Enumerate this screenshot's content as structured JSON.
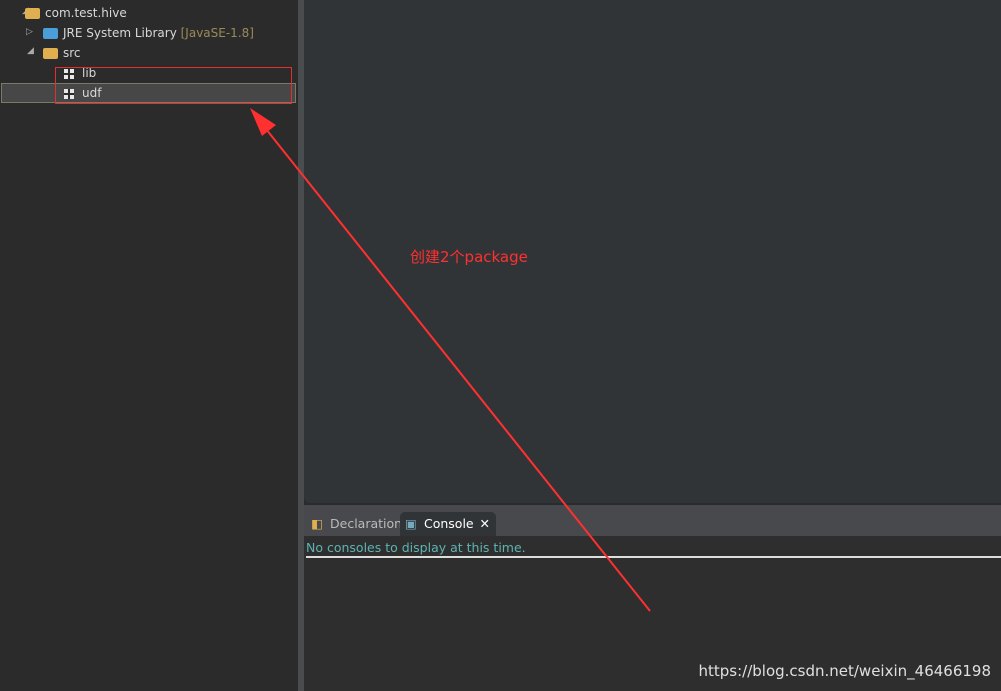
{
  "tree": {
    "project": "com.test.hive",
    "jre_label": "JRE System Library",
    "jre_version": "[JavaSE-1.8]",
    "src": "src",
    "packages": [
      "lib",
      "udf"
    ],
    "selected": "udf"
  },
  "bottom_panel": {
    "tabs": [
      {
        "label": "Declaration",
        "active": false
      },
      {
        "label": "Console",
        "active": true
      }
    ],
    "console_message": "No consoles to display at this time."
  },
  "annotation": {
    "text": "创建2个package",
    "color": "#ff3030"
  },
  "watermark": "https://blog.csdn.net/weixin_46466198"
}
